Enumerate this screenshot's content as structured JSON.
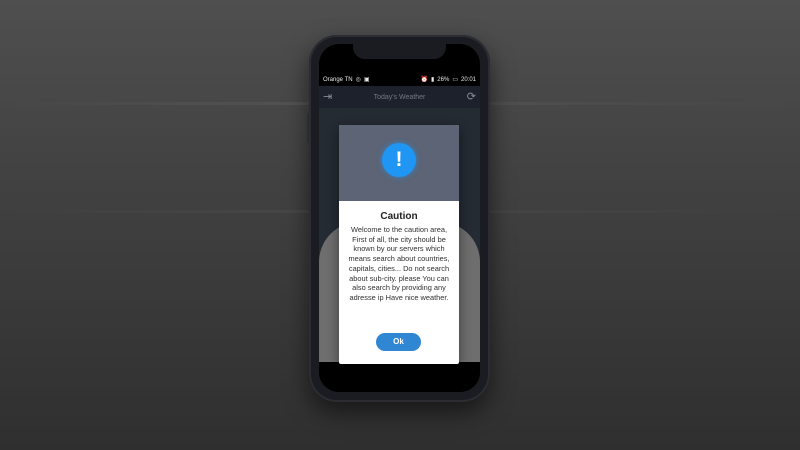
{
  "status_bar": {
    "carrier": "Orange TN",
    "battery": "26%",
    "time": "20:01"
  },
  "app_bar": {
    "title": "Today's Weather",
    "left_icon": "menu-arrow-icon",
    "right_icon": "refresh-icon"
  },
  "dialog": {
    "icon": "alert-icon",
    "icon_glyph": "!",
    "title": "Caution",
    "message": "Welcome to the caution area, First of all, the city should be known by our servers which means search about countries, capitals, cities... Do not search about sub-city. please You can also search by providing any adresse ip Have nice weather.",
    "ok_label": "Ok",
    "accent_color": "#1f96f3",
    "button_color": "#2f86d2"
  }
}
